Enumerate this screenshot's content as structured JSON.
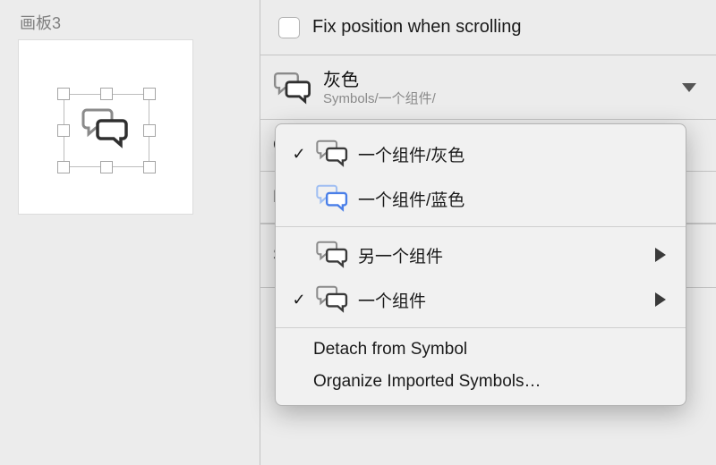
{
  "canvas": {
    "artboard_title": "画板3"
  },
  "inspector": {
    "fix_position_label": "Fix position when scrolling",
    "symbol": {
      "name": "灰色",
      "path": "Symbols/一个组件/"
    },
    "truncated_rows": [
      "C",
      "E",
      "S"
    ]
  },
  "menu": {
    "items": [
      {
        "checked": true,
        "icon": "chat-gray",
        "label": "一个组件/灰色",
        "submenu": false
      },
      {
        "checked": false,
        "icon": "chat-blue",
        "label": "一个组件/蓝色",
        "submenu": false
      }
    ],
    "items2": [
      {
        "checked": false,
        "icon": "chat-gray",
        "label": "另一个组件",
        "submenu": true
      },
      {
        "checked": true,
        "icon": "chat-gray",
        "label": "一个组件",
        "submenu": true
      }
    ],
    "actions": [
      "Detach from Symbol",
      "Organize Imported Symbols…"
    ]
  },
  "colors": {
    "gray_stroke": "#5b5b5b",
    "blue_stroke": "#4a7fe8",
    "dark_stroke": "#2f2f2f"
  }
}
